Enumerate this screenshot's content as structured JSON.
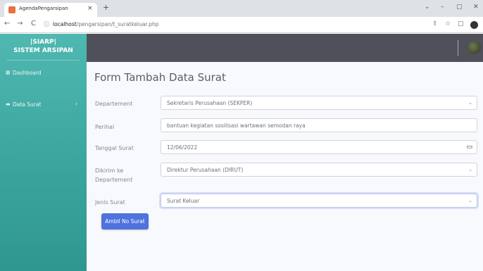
{
  "browser": {
    "tab_title": "AgendaPengarsipan",
    "tab_close": "×",
    "new_tab": "+",
    "window_controls": [
      "⌄",
      "–",
      "▢",
      "✕"
    ],
    "url_host": "localhost",
    "url_path": "/pengarsipan/t_suratkeluar.php",
    "nav_back": "←",
    "nav_forward": "→",
    "nav_reload": "C",
    "info_icon": "ⓘ",
    "tool_icons": [
      "⇪",
      "☆",
      "▢"
    ],
    "colors": {
      "tab_favicon": "#e8713c"
    }
  },
  "sidebar": {
    "brand_line1": "|SIARP|",
    "brand_line2": "SISTEM ARSIPAN",
    "items": [
      {
        "label": "Dashboard",
        "icon": "dashboard-icon"
      },
      {
        "label": "Data Surat",
        "icon": "folder-icon",
        "chevron": "›"
      }
    ]
  },
  "topbar": {
    "avatar": "user-avatar"
  },
  "main": {
    "title": "Form Tambah Data Surat",
    "fields": [
      {
        "label": "Departement",
        "value": "Sekretaris Perusahaan (SEKPER)",
        "type": "select"
      },
      {
        "label": "Perihal",
        "value": "bantuan kegiatan sosilisasi wartawan semodan raya",
        "type": "text"
      },
      {
        "label": "Tanggal Surat",
        "value": "12/06/2022",
        "type": "date"
      },
      {
        "label_line1": "Dikirim ke",
        "label_line2": "Departement",
        "value": "Direktur Perusahaan (DIRUT)",
        "type": "select"
      },
      {
        "label": "Jenis Surat",
        "value": "Surat Keluar",
        "type": "select"
      }
    ],
    "button_label": "Ambil No Surat"
  },
  "colors": {
    "sidebar": "#3aa49c",
    "topbar": "#50505a",
    "primary": "#4e73df",
    "background": "#f8f9fc"
  }
}
